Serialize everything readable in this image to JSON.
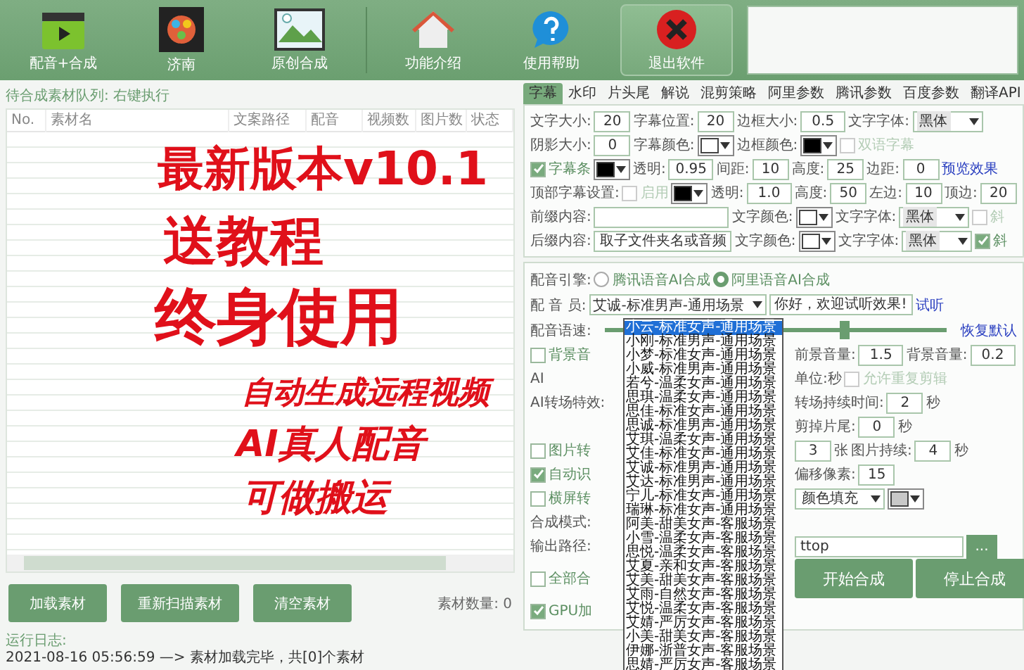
{
  "toolbar": {
    "buttons": [
      {
        "kind": "dub",
        "label": "配音+合成"
      },
      {
        "kind": "reel",
        "label": "济南"
      },
      {
        "kind": "picture",
        "label": "原创合成"
      },
      {
        "kind": "home",
        "label": "功能介绍"
      },
      {
        "kind": "help",
        "label": "使用帮助"
      },
      {
        "kind": "exit",
        "label": "退出软件"
      }
    ]
  },
  "queue": {
    "title": "待合成素材队列: 右键执行",
    "columns": [
      "No.",
      "素材名",
      "文案路径",
      "配音",
      "视频数",
      "图片数",
      "状态"
    ],
    "buttons": [
      "加载素材",
      "重新扫描素材",
      "清空素材"
    ],
    "count": "素材数量: 0"
  },
  "log": {
    "title": "运行日志:",
    "lines": [
      "2021-08-16 05:56:59 —> 素材加载完毕，共[0]个素材"
    ]
  },
  "tabs": [
    {
      "label": "字幕",
      "selected": true
    },
    {
      "label": "水印",
      "selected": false
    },
    {
      "label": "片头尾",
      "selected": false
    },
    {
      "label": "解说",
      "selected": false
    },
    {
      "label": "混剪策略",
      "selected": false
    },
    {
      "label": "阿里参数",
      "selected": false
    },
    {
      "label": "腾讯参数",
      "selected": false
    },
    {
      "label": "百度参数",
      "selected": false
    },
    {
      "label": "翻译API",
      "selected": false
    }
  ],
  "subtitle_rows": [
    [
      {
        "kind": "label",
        "text": "文字大小:"
      },
      {
        "kind": "number",
        "value": "20"
      },
      {
        "kind": "label",
        "text": "字幕位置:"
      },
      {
        "kind": "number",
        "value": "20"
      },
      {
        "kind": "label",
        "text": "边框大小:"
      },
      {
        "kind": "number",
        "value": "0.5"
      },
      {
        "kind": "label",
        "text": "文字字体:"
      },
      {
        "kind": "select",
        "value": "黑体"
      }
    ],
    [
      {
        "kind": "label",
        "text": "阴影大小:"
      },
      {
        "kind": "number",
        "value": "0"
      },
      {
        "kind": "label",
        "text": "字幕颜色:"
      },
      {
        "kind": "color",
        "color": "#ffffff"
      },
      {
        "kind": "label",
        "text": "边框颜色:"
      },
      {
        "kind": "color",
        "color": "#000000"
      },
      {
        "kind": "checkbox",
        "label": "双语字幕",
        "checked": false,
        "disabled": true
      }
    ],
    [
      {
        "kind": "checkbox",
        "label": "字幕条",
        "checked": true,
        "disabled": false
      },
      {
        "kind": "color",
        "color": "#000000"
      },
      {
        "kind": "label",
        "text": "透明:"
      },
      {
        "kind": "number",
        "value": "0.95"
      },
      {
        "kind": "label",
        "text": "间距:"
      },
      {
        "kind": "number",
        "value": "10"
      },
      {
        "kind": "label",
        "text": "高度:"
      },
      {
        "kind": "number",
        "value": "25"
      },
      {
        "kind": "label",
        "text": "边距:"
      },
      {
        "kind": "number",
        "value": "0"
      },
      {
        "kind": "link",
        "text": "预览效果"
      }
    ],
    [
      {
        "kind": "label",
        "text": "顶部字幕设置:"
      },
      {
        "kind": "checkbox",
        "label": "启用",
        "checked": false,
        "disabled": true
      },
      {
        "kind": "color",
        "color": "#000000"
      },
      {
        "kind": "label",
        "text": "透明:"
      },
      {
        "kind": "number",
        "value": "1.0"
      },
      {
        "kind": "label",
        "text": "高度:"
      },
      {
        "kind": "number",
        "value": "50"
      },
      {
        "kind": "label",
        "text": "左边:"
      },
      {
        "kind": "number",
        "value": "10"
      },
      {
        "kind": "label",
        "text": "顶边:"
      },
      {
        "kind": "number",
        "value": "20"
      }
    ],
    [
      {
        "kind": "label",
        "text": "前缀内容:"
      },
      {
        "kind": "text"
      },
      {
        "kind": "label",
        "text": "文字颜色:"
      },
      {
        "kind": "color",
        "color": "#ffffff"
      },
      {
        "kind": "label",
        "text": "文字字体:"
      },
      {
        "kind": "select",
        "value": "黑体"
      },
      {
        "kind": "checkbox",
        "label": "斜",
        "checked": false,
        "disabled": true
      }
    ],
    [
      {
        "kind": "label",
        "text": "后缀内容:"
      },
      {
        "kind": "text",
        "value": "取子文件夹名或音频"
      },
      {
        "kind": "label",
        "text": "文字颜色:"
      },
      {
        "kind": "color",
        "color": "#ffffff"
      },
      {
        "kind": "label",
        "text": "文字字体:"
      },
      {
        "kind": "select",
        "value": "黑体"
      },
      {
        "kind": "checkbox",
        "label": "斜",
        "checked": true,
        "disabled": false
      }
    ]
  ],
  "voice_rows": [
    {
      "full": [
        {
          "kind": "label",
          "text": "配音引擎:"
        },
        {
          "kind": "radio",
          "label": "腾讯语音AI合成",
          "selected": false
        },
        {
          "kind": "radio",
          "label": "阿里语音AI合成",
          "selected": true
        }
      ]
    },
    {
      "full": [
        {
          "kind": "label",
          "text": "配 音 员:"
        },
        {
          "kind": "voiceselect",
          "value": "艾诚-标准男声-通用场景"
        },
        {
          "kind": "text",
          "value": "你好，欢迎试听效果!"
        },
        {
          "kind": "link",
          "text": "试听"
        }
      ]
    },
    {
      "full": [
        {
          "kind": "label",
          "text": "配音语速:"
        },
        {
          "kind": "slider",
          "level": 0.7
        },
        {
          "kind": "link",
          "text": "恢复默认"
        }
      ]
    },
    {
      "left": [
        {
          "kind": "checkbox",
          "label": "背景音",
          "checked": false,
          "disabled": false
        }
      ],
      "right": [
        {
          "kind": "label",
          "text": "前景音量:"
        },
        {
          "kind": "number",
          "value": "1.5"
        },
        {
          "kind": "label",
          "text": "背景音量:"
        },
        {
          "kind": "number",
          "value": "0.2"
        }
      ]
    },
    {
      "left": [
        {
          "kind": "label",
          "text": "AI"
        }
      ],
      "right": [
        {
          "kind": "label",
          "text": "单位:秒"
        },
        {
          "kind": "checkbox",
          "label": "允许重复剪辑",
          "checked": false,
          "disabled": true
        }
      ]
    },
    {
      "left": [
        {
          "kind": "label",
          "text": "AI转场特效:"
        }
      ],
      "right": [
        {
          "kind": "label",
          "text": "转场持续时间:"
        },
        {
          "kind": "number",
          "value": "2"
        },
        {
          "kind": "label",
          "text": "秒"
        }
      ]
    },
    {
      "right": [
        {
          "kind": "label",
          "text": "剪掉片尾:"
        },
        {
          "kind": "number",
          "value": "0"
        },
        {
          "kind": "label",
          "text": "秒"
        }
      ]
    },
    {
      "left": [
        {
          "kind": "checkbox",
          "label": "图片转",
          "checked": false,
          "disabled": false
        }
      ],
      "right": [
        {
          "kind": "number",
          "value": "3"
        },
        {
          "kind": "label",
          "text": "张"
        },
        {
          "kind": "label",
          "text": "图片持续:"
        },
        {
          "kind": "number",
          "value": "4"
        },
        {
          "kind": "label",
          "text": "秒"
        }
      ]
    },
    {
      "left": [
        {
          "kind": "checkbox",
          "label": "自动识",
          "checked": true,
          "disabled": false
        }
      ],
      "right": [
        {
          "kind": "label",
          "text": "偏移像素:"
        },
        {
          "kind": "number",
          "value": "15"
        }
      ]
    },
    {
      "left": [
        {
          "kind": "checkbox",
          "label": "横屏转",
          "checked": false,
          "disabled": false
        }
      ],
      "right": [
        {
          "kind": "select",
          "value": "颜色填充"
        },
        {
          "kind": "color",
          "color": "#c8c8c8"
        }
      ]
    },
    {
      "left": [
        {
          "kind": "label",
          "text": "合成模式:"
        }
      ]
    },
    {
      "left": [
        {
          "kind": "label",
          "text": "输出路径:"
        }
      ],
      "right": [
        {
          "kind": "path",
          "value": "ttop"
        },
        {
          "kind": "browse",
          "text": "..."
        }
      ]
    },
    {
      "left": [
        {
          "kind": "checkbox",
          "label": "全部合",
          "checked": false,
          "disabled": false
        }
      ],
      "right": [
        {
          "kind": "bigbutton",
          "text": "开始合成"
        },
        {
          "kind": "bigbutton",
          "text": "停止合成"
        }
      ]
    },
    {
      "left": [
        {
          "kind": "checkbox",
          "label": "GPU加",
          "checked": true,
          "disabled": false
        }
      ]
    }
  ],
  "voice_list": [
    {
      "label": "小云-标准女声-通用场景",
      "selected": true
    },
    {
      "label": "小刚-标准男声-通用场景",
      "selected": false
    },
    {
      "label": "小梦-标准女声-通用场景",
      "selected": false
    },
    {
      "label": "小威-标准男声-通用场景",
      "selected": false
    },
    {
      "label": "若兮-温柔女声-通用场景",
      "selected": false
    },
    {
      "label": "思琪-温柔女声-通用场景",
      "selected": false
    },
    {
      "label": "思佳-标准女声-通用场景",
      "selected": false
    },
    {
      "label": "思诚-标准男声-通用场景",
      "selected": false
    },
    {
      "label": "艾琪-温柔女声-通用场景",
      "selected": false
    },
    {
      "label": "艾佳-标准女声-通用场景",
      "selected": false
    },
    {
      "label": "艾诚-标准男声-通用场景",
      "selected": false
    },
    {
      "label": "艾达-标准男声-通用场景",
      "selected": false
    },
    {
      "label": "宁儿-标准女声-通用场景",
      "selected": false
    },
    {
      "label": "瑞琳-标准女声-通用场景",
      "selected": false
    },
    {
      "label": "阿美-甜美女声-客服场景",
      "selected": false
    },
    {
      "label": "小雪-温柔女声-客服场景",
      "selected": false
    },
    {
      "label": "思悦-温柔女声-客服场景",
      "selected": false
    },
    {
      "label": "艾夏-亲和女声-客服场景",
      "selected": false
    },
    {
      "label": "艾美-甜美女声-客服场景",
      "selected": false
    },
    {
      "label": "艾雨-自然女声-客服场景",
      "selected": false
    },
    {
      "label": "艾悦-温柔女声-客服场景",
      "selected": false
    },
    {
      "label": "艾婧-严厉女声-客服场景",
      "selected": false
    },
    {
      "label": "小美-甜美女声-客服场景",
      "selected": false
    },
    {
      "label": "伊娜-浙普女声-客服场景",
      "selected": false
    },
    {
      "label": "思婧-严厉女声-客服场景",
      "selected": false
    }
  ],
  "promo": [
    "最新版本v10.1",
    "送教程",
    "终身使用",
    "自动生成远程视频",
    "AI真人配音",
    "可做搬运"
  ]
}
